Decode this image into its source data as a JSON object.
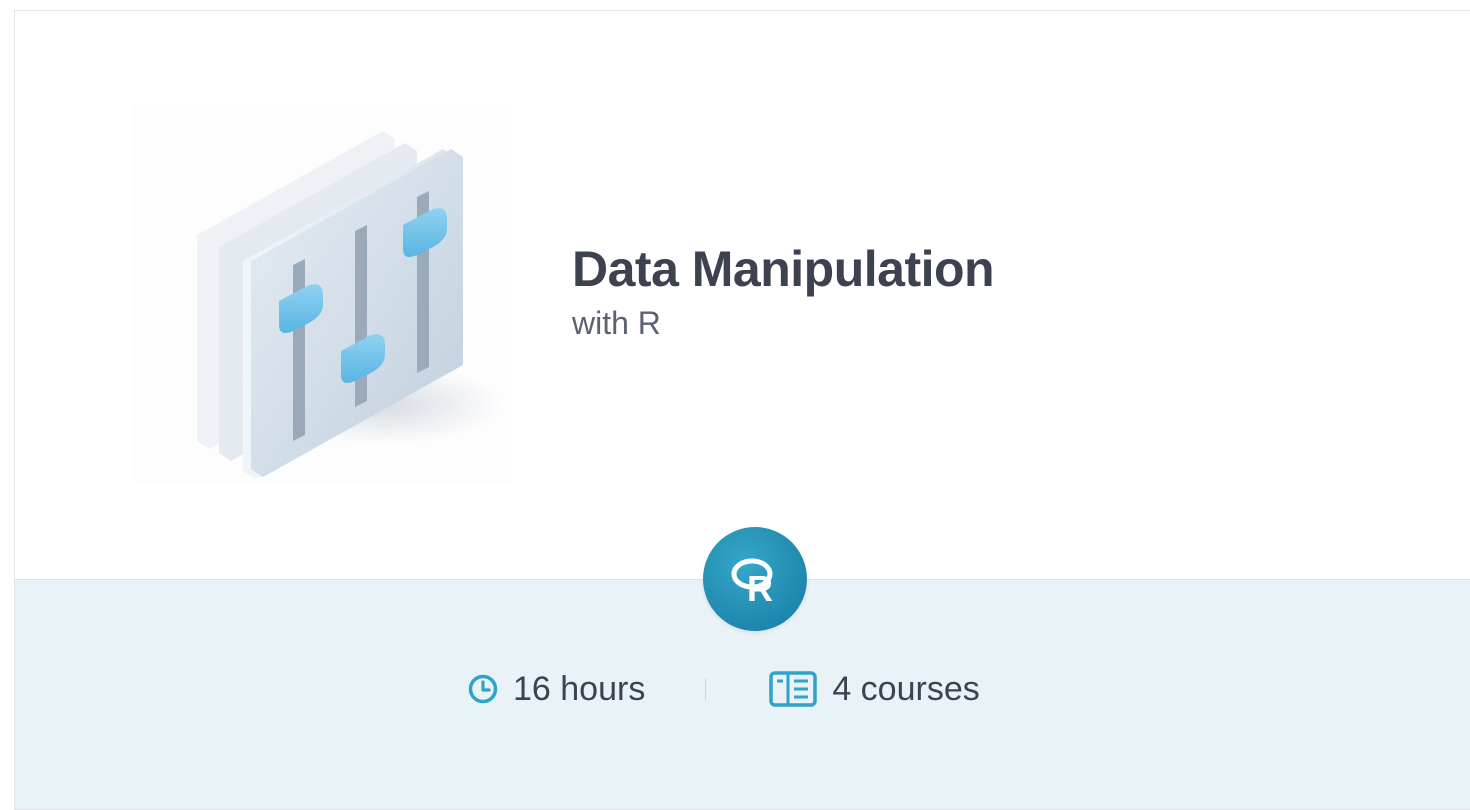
{
  "track": {
    "title": "Data Manipulation",
    "subtitle": "with R",
    "illustration_icon": "sliders-icon",
    "technology": {
      "icon": "r-language-icon",
      "letter": "R",
      "color": "#2190b5"
    },
    "meta": {
      "duration_icon": "clock-icon",
      "duration": "16 hours",
      "courses_icon": "courses-icon",
      "courses": "4 courses"
    },
    "colors": {
      "accent": "#2fa3c8",
      "title": "#3d4251",
      "footer_bg": "#e9f2f6"
    }
  }
}
